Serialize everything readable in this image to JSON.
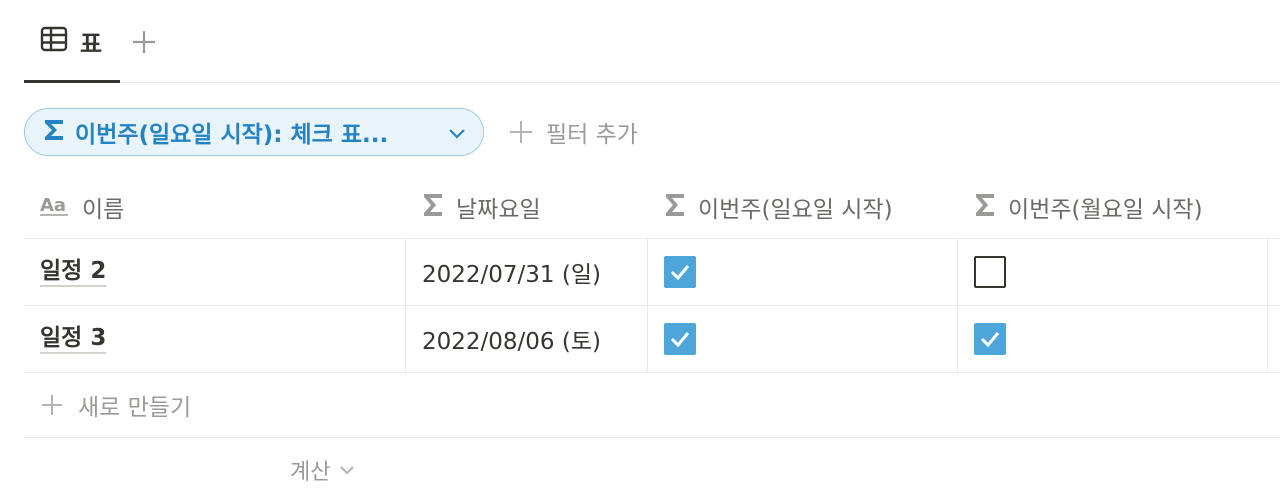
{
  "tabs": {
    "active_view_label": "표"
  },
  "filter": {
    "chip_label": "이번주(일요일 시작): 체크 표...",
    "add_filter_label": "필터 추가"
  },
  "table": {
    "columns": [
      {
        "label": "이름",
        "icon": "text-type-icon"
      },
      {
        "label": "날짜요일",
        "icon": "sigma-icon"
      },
      {
        "label": "이번주(일요일 시작)",
        "icon": "sigma-icon"
      },
      {
        "label": "이번주(월요일 시작)",
        "icon": "sigma-icon"
      }
    ],
    "rows": [
      {
        "name": "일정 2",
        "date": "2022/07/31 (일)",
        "sunday_week": true,
        "monday_week": false
      },
      {
        "name": "일정 3",
        "date": "2022/08/06 (토)",
        "sunday_week": true,
        "monday_week": true
      }
    ],
    "new_row_label": "새로 만들기",
    "calc_label": "계산"
  },
  "colors": {
    "accent": "#2383c5",
    "checkbox_checked": "#4ea5d9",
    "chip_bg": "#e9f3fa"
  }
}
